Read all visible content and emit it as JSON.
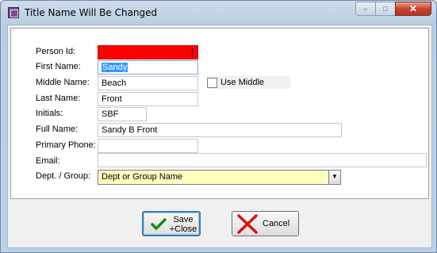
{
  "window": {
    "title": "Title Name Will Be Changed",
    "controls": {
      "minimize": "–",
      "maximize": "□",
      "close": "✕"
    }
  },
  "form": {
    "person_id": {
      "label": "Person Id:",
      "value": ""
    },
    "first_name": {
      "label": "First Name:",
      "value": "Sandy"
    },
    "middle_name": {
      "label": "Middle Name:",
      "value": "Beach"
    },
    "use_middle": {
      "label": "Use Middle",
      "checked": false
    },
    "last_name": {
      "label": "Last Name:",
      "value": "Front"
    },
    "initials": {
      "label": "Initials:",
      "value": "SBF"
    },
    "full_name": {
      "label": "Full Name:",
      "value": "Sandy B Front"
    },
    "primary_phone": {
      "label": "Primary Phone:",
      "value": ""
    },
    "email": {
      "label": "Email:",
      "value": ""
    },
    "dept_group": {
      "label": "Dept. / Group:",
      "value": "Dept or Group Name"
    }
  },
  "buttons": {
    "save": {
      "label_line1": "Save",
      "label_line2": "+Close",
      "icon": "checkmark-icon"
    },
    "cancel": {
      "label": "Cancel",
      "icon": "red-x-icon"
    }
  },
  "colors": {
    "person_id_bg": "#ff0000",
    "dept_combo_bg": "#ffffc0",
    "selection": "#3399ff"
  }
}
